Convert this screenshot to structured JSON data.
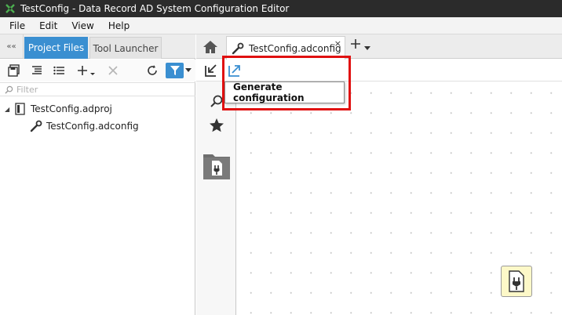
{
  "window": {
    "title": "TestConfig - Data Record AD System Configuration Editor"
  },
  "menu": {
    "file": "File",
    "edit": "Edit",
    "view": "View",
    "help": "Help"
  },
  "left_panel": {
    "collapse_glyph": "««",
    "tabs": {
      "project_files": "Project Files",
      "tool_launcher": "Tool Launcher"
    },
    "filter": {
      "placeholder": "Filter"
    },
    "tree": {
      "project": "TestConfig.adproj",
      "config": "TestConfig.adconfig"
    }
  },
  "editor": {
    "tab_label": "TestConfig.adconfig",
    "tab_close": "×",
    "tooltip": "Generate configuration"
  },
  "colors": {
    "accent": "#3a8fd1",
    "titlebar": "#2b2b2b",
    "highlight": "#e01010",
    "plugin_node": "#fdf8c8"
  }
}
